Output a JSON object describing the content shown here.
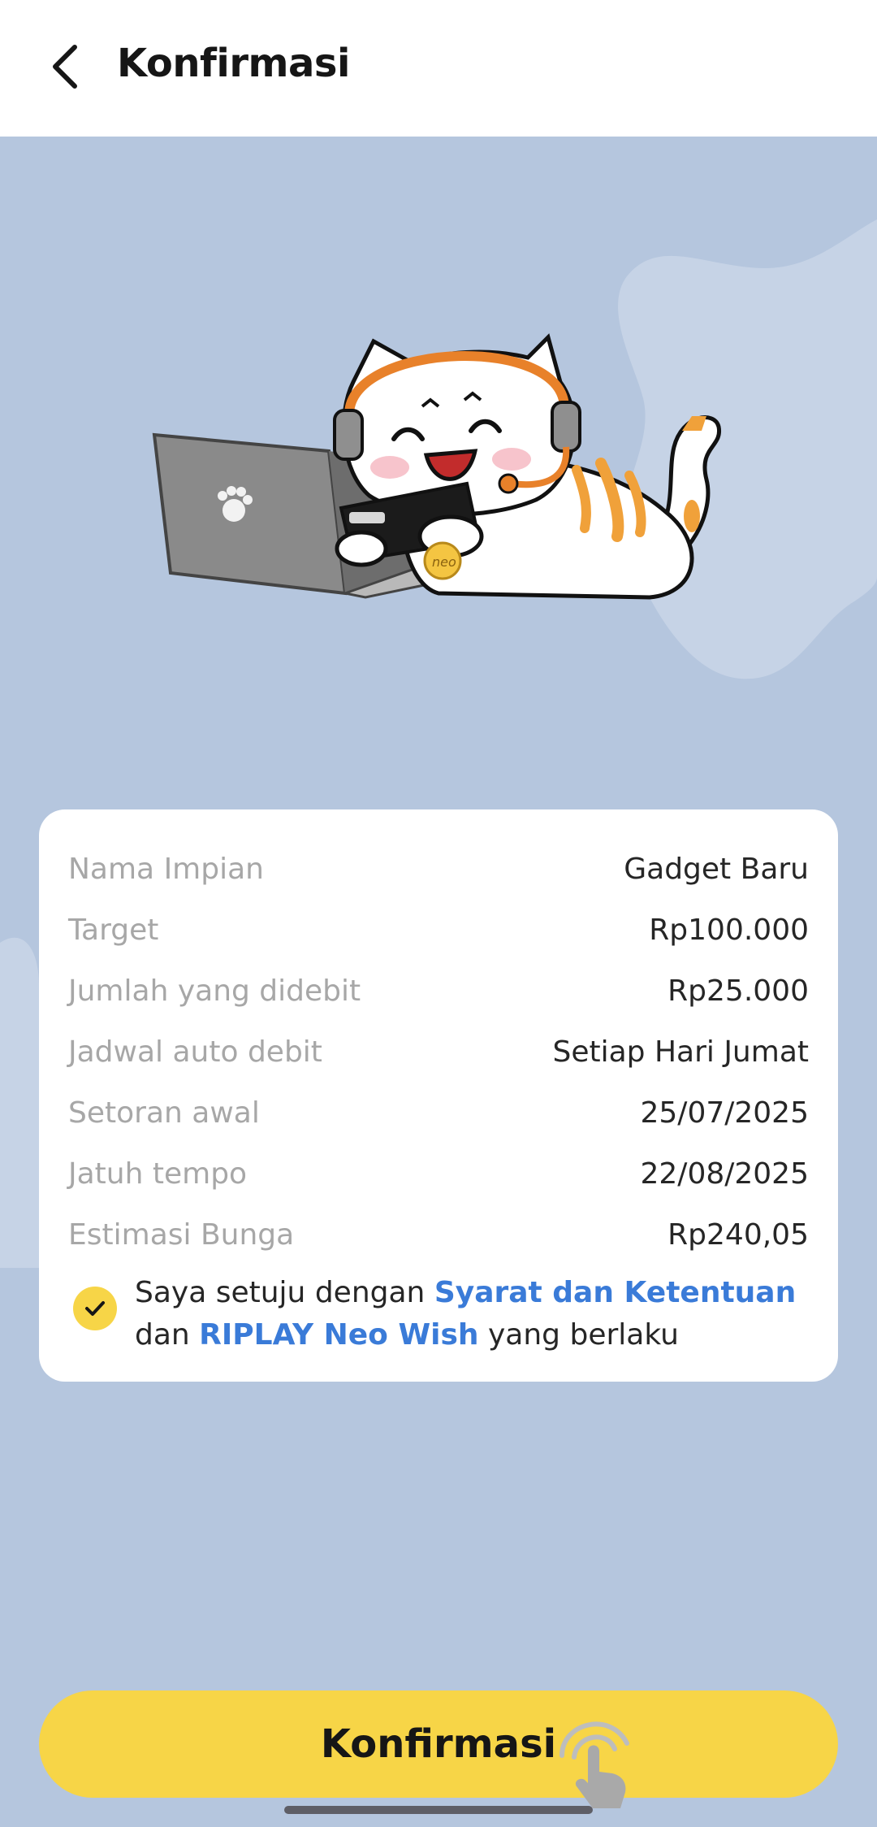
{
  "header": {
    "title": "Konfirmasi"
  },
  "summary": {
    "rows": [
      {
        "label": "Nama Impian",
        "value": "Gadget Baru"
      },
      {
        "label": "Target",
        "value": "Rp100.000"
      },
      {
        "label": "Jumlah yang didebit",
        "value": "Rp25.000"
      },
      {
        "label": "Jadwal auto debit",
        "value": "Setiap Hari Jumat"
      },
      {
        "label": "Setoran awal",
        "value": "25/07/2025"
      },
      {
        "label": "Jatuh tempo",
        "value": "22/08/2025"
      },
      {
        "label": "Estimasi Bunga",
        "value": "Rp240,05"
      }
    ]
  },
  "agreement": {
    "checked": true,
    "text_1": "Saya setuju dengan ",
    "link_1": "Syarat dan Ketentuan",
    "text_2": "dan ",
    "link_2": "RIPLAY Neo Wish",
    "text_3": " yang berlaku"
  },
  "footer": {
    "confirm_label": "Konfirmasi"
  },
  "illustration": {
    "mascot_badge": "neo"
  },
  "colors": {
    "background": "#b5c6de",
    "accent_yellow": "#f7d547",
    "link_blue": "#3a7bd8"
  }
}
